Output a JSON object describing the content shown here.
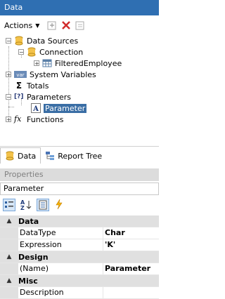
{
  "window": {
    "title": "Data"
  },
  "toolbar": {
    "actions_label": "Actions",
    "icons": [
      "new-item-icon",
      "delete-icon",
      "edit-icon"
    ]
  },
  "tree": {
    "items": [
      {
        "label": "Data Sources",
        "icon": "database-icon"
      },
      {
        "label": "Connection",
        "icon": "database-connection-icon"
      },
      {
        "label": "FilteredEmployee",
        "icon": "table-icon"
      },
      {
        "label": "System Variables",
        "icon": "variable-icon",
        "icon_text": "var"
      },
      {
        "label": "Totals",
        "icon": "sigma-icon",
        "icon_text": "Σ"
      },
      {
        "label": "Parameters",
        "icon": "parameters-icon",
        "icon_text": "[?]"
      },
      {
        "label": "Parameter",
        "icon": "text-parameter-icon",
        "icon_text": "A"
      },
      {
        "label": "Functions",
        "icon": "function-icon",
        "icon_text": "fx"
      }
    ]
  },
  "tabs": [
    {
      "label": "Data",
      "icon": "database-icon"
    },
    {
      "label": "Report Tree",
      "icon": "tree-icon"
    }
  ],
  "properties": {
    "header": "Properties",
    "selected_object": "Parameter",
    "categories": [
      {
        "name": "Data",
        "rows": [
          {
            "name": "DataType",
            "value": "Char"
          },
          {
            "name": "Expression",
            "value": "'K'"
          }
        ]
      },
      {
        "name": "Design",
        "rows": [
          {
            "name": "(Name)",
            "value": "Parameter"
          }
        ]
      },
      {
        "name": "Misc",
        "rows": [
          {
            "name": "Description",
            "value": ""
          }
        ]
      }
    ]
  },
  "colors": {
    "titlebar": "#2f6fb2",
    "selection": "#3a6ea5"
  }
}
